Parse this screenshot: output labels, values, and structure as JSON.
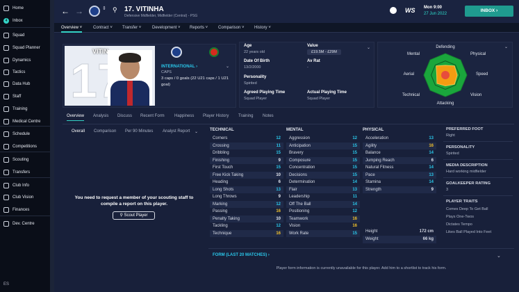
{
  "sidebar": {
    "items": [
      "Home",
      "Inbox",
      "Squad",
      "Squad Planner",
      "Dynamics",
      "Tactics",
      "Data Hub",
      "Staff",
      "Training",
      "Medical Centre",
      "Schedule",
      "Competitions",
      "Scouting",
      "Transfers",
      "Club Info",
      "Club Vision",
      "Finances",
      "Dev. Centre"
    ],
    "inbox_badge": "4",
    "footer": "ES"
  },
  "header": {
    "title": "17. VITINHA",
    "subtitle": "Defensive Midfielder, Midfielder (Central) - PSG",
    "date_day": "Mon 9:00",
    "date": "27 Jun 2022",
    "inbox_button": "INBOX"
  },
  "nav": {
    "items": [
      "Overview",
      "Contract",
      "Transfer",
      "Development",
      "Reports",
      "Comparison",
      "History"
    ]
  },
  "profile": {
    "shirt_text": "VITIN",
    "international_label": "INTERNATIONAL",
    "caps_label": "CAPS",
    "caps_text": "3 caps / 0 goals (22 U21 caps / 1 U21 goal)"
  },
  "bio": {
    "age_label": "Age",
    "age_value": "22 years old",
    "value_label": "Value",
    "value_value": "£19.5M - £29M",
    "dob_label": "Date Of Birth",
    "dob_value": "13/2/2000",
    "avrat_label": "Av Rat",
    "avrat_value": "-",
    "personality_label": "Personality",
    "personality_value": "Spirited",
    "agreed_label": "Agreed Playing Time",
    "agreed_value": "Squad Player",
    "actual_label": "Actual Playing Time",
    "actual_value": "Squad Player"
  },
  "radar": {
    "labels": [
      "Defending",
      "Physical",
      "Speed",
      "Vision",
      "Attacking",
      "Technical",
      "Aerial",
      "Mental"
    ],
    "values": [
      0.45,
      0.6,
      0.55,
      0.6,
      0.5,
      0.55,
      0.4,
      0.6
    ],
    "colors": {
      "fill": "#f39c12",
      "center": "#e74c3c",
      "hull": "#1aa63c"
    }
  },
  "subtabs": [
    "Overview",
    "Analysis",
    "Discuss",
    "Recent Form",
    "Happiness",
    "Player History",
    "Training",
    "Notes"
  ],
  "subsubtabs": [
    "Overall",
    "Comparison",
    "Per 90 Minutes",
    "Analyst Report"
  ],
  "scout": {
    "message": "You need to request a member of your scouting staff to compile a report on this player.",
    "button": "Scout Player"
  },
  "technical": {
    "title": "TECHNICAL",
    "rows": [
      [
        "Corners",
        "12"
      ],
      [
        "Crossing",
        "11"
      ],
      [
        "Dribbling",
        "15"
      ],
      [
        "Finishing",
        "9"
      ],
      [
        "First Touch",
        "15"
      ],
      [
        "Free Kick Taking",
        "10"
      ],
      [
        "Heading",
        "6"
      ],
      [
        "Long Shots",
        "13"
      ],
      [
        "Long Throws",
        "9"
      ],
      [
        "Marking",
        "12"
      ],
      [
        "Passing",
        "16"
      ],
      [
        "Penalty Taking",
        "10"
      ],
      [
        "Tackling",
        "12"
      ],
      [
        "Technique",
        "16"
      ]
    ]
  },
  "mental": {
    "title": "MENTAL",
    "rows": [
      [
        "Aggression",
        "12"
      ],
      [
        "Anticipation",
        "15"
      ],
      [
        "Bravery",
        "15"
      ],
      [
        "Composure",
        "15"
      ],
      [
        "Concentration",
        "15"
      ],
      [
        "Decisions",
        "15"
      ],
      [
        "Determination",
        "14"
      ],
      [
        "Flair",
        "13"
      ],
      [
        "Leadership",
        "11"
      ],
      [
        "Off The Ball",
        "14"
      ],
      [
        "Positioning",
        "12"
      ],
      [
        "Teamwork",
        "16"
      ],
      [
        "Vision",
        "16"
      ],
      [
        "Work Rate",
        "15"
      ]
    ]
  },
  "physical": {
    "title": "PHYSICAL",
    "rows": [
      [
        "Acceleration",
        "13"
      ],
      [
        "Agility",
        "16"
      ],
      [
        "Balance",
        "14"
      ],
      [
        "Jumping Reach",
        "6"
      ],
      [
        "Natural Fitness",
        "14"
      ],
      [
        "Pace",
        "13"
      ],
      [
        "Stamina",
        "14"
      ],
      [
        "Strength",
        "9"
      ]
    ],
    "height_label": "Height",
    "height_value": "172 cm",
    "weight_label": "Weight",
    "weight_value": "66 kg"
  },
  "info": {
    "foot_label": "PREFERRED FOOT",
    "foot_value": "Right",
    "personality_label": "PERSONALITY",
    "personality_value": "Spirited",
    "media_label": "MEDIA DESCRIPTION",
    "media_value": "Hard working midfielder",
    "gk_label": "GOALKEEPER RATING",
    "gk_value": "3",
    "traits_label": "PLAYER TRAITS",
    "traits": [
      "Comes Deep To Get Ball",
      "Plays One-Twos",
      "Dictates Tempo",
      "Likes Ball Played Into Feet"
    ]
  },
  "form": {
    "title": "FORM (LAST 20 MATCHES)",
    "message": "Player form information is currently unavailable for this player. Add him to a shortlist to track his form."
  }
}
